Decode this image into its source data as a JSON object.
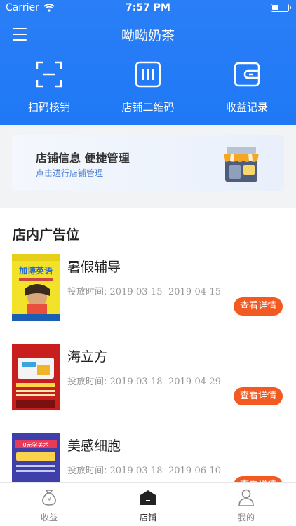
{
  "status_bar": {
    "carrier": "Carrier",
    "time": "7:57 PM"
  },
  "header": {
    "title": "呦呦奶茶"
  },
  "actions": [
    {
      "label": "扫码核销",
      "icon": "scan-icon"
    },
    {
      "label": "店铺二维码",
      "icon": "qrcode-icon"
    },
    {
      "label": "收益记录",
      "icon": "wallet-icon"
    }
  ],
  "shop_card": {
    "heading": "店铺信息  便捷管理",
    "subtitle": "点击进行店铺管理",
    "icon": "store-icon"
  },
  "ads": {
    "section_title": "店内广告位",
    "period_label": "投放时间:",
    "items": [
      {
        "name": "暑假辅导",
        "period": "2019-03-15- 2019-04-15",
        "button": "查看详情",
        "thumb_text": "加博英语"
      },
      {
        "name": "海立方",
        "period": "2019-03-18- 2019-04-29",
        "button": "查看详情"
      },
      {
        "name": "美感细胞",
        "period": "2019-03-18- 2019-06-10",
        "button": "查看详情",
        "thumb_text": "0元学美术"
      }
    ]
  },
  "tabbar": [
    {
      "label": "收益",
      "icon": "money-bag-icon",
      "active": false
    },
    {
      "label": "店铺",
      "icon": "shop-icon",
      "active": true
    },
    {
      "label": "我的",
      "icon": "user-icon",
      "active": false
    }
  ],
  "colors": {
    "primary": "#1f78f5",
    "accent_button": "#f25a22",
    "card_text": "#4b7fd8"
  }
}
